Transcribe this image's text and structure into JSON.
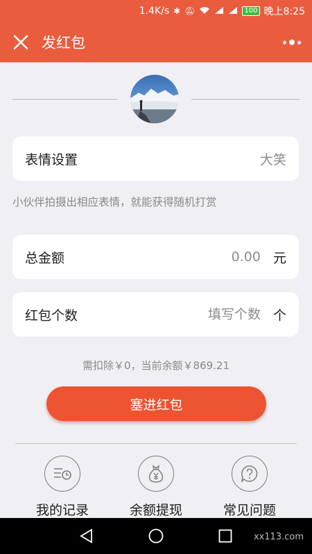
{
  "statusbar": {
    "speed": "1.4K/s",
    "battery": "100",
    "time": "晚上8:25"
  },
  "appbar": {
    "title": "发红包"
  },
  "expression": {
    "label": "表情设置",
    "value": "大笑"
  },
  "hint": "小伙伴拍摄出相应表情，就能获得随机打赏",
  "total_amount": {
    "label": "总金额",
    "placeholder": "0.00",
    "unit": "元"
  },
  "count": {
    "label": "红包个数",
    "placeholder": "填写个数",
    "unit": "个"
  },
  "balance_note": "需扣除￥0，当前余额￥869.21",
  "submit_label": "塞进红包",
  "actions": [
    {
      "label": "我的记录",
      "icon": "records-icon"
    },
    {
      "label": "余额提现",
      "icon": "money-bag-icon"
    },
    {
      "label": "常见问题",
      "icon": "question-icon"
    }
  ],
  "watermark": "xx113.com",
  "colors": {
    "brand": "#ea5c3e",
    "button": "#ec5431",
    "background": "#efeff4"
  }
}
